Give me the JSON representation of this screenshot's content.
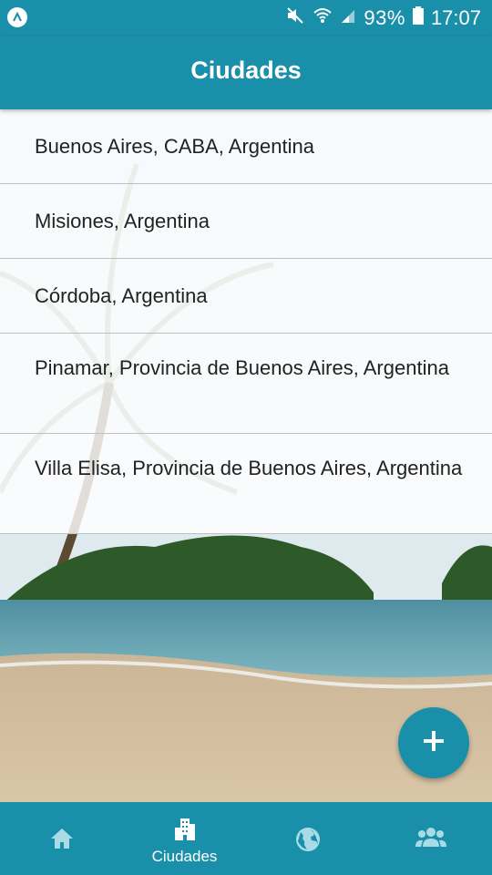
{
  "status_bar": {
    "battery_percent": "93%",
    "time": "17:07",
    "icons": [
      "app-notification-icon",
      "mute-icon",
      "wifi-icon",
      "signal-icon",
      "battery-icon"
    ]
  },
  "app_bar": {
    "title": "Ciudades"
  },
  "cities": [
    "Buenos Aires, CABA, Argentina",
    "Misiones, Argentina",
    "Córdoba, Argentina",
    "Pinamar, Provincia de Buenos Aires, Argentina",
    "Villa Elisa, Provincia de Buenos Aires, Argentina"
  ],
  "fab": {
    "icon": "plus-icon"
  },
  "bottom_nav": {
    "items": [
      {
        "icon": "home-icon",
        "label": "",
        "active": false
      },
      {
        "icon": "city-icon",
        "label": "Ciudades",
        "active": true
      },
      {
        "icon": "globe-icon",
        "label": "",
        "active": false
      },
      {
        "icon": "people-icon",
        "label": "",
        "active": false
      }
    ]
  },
  "colors": {
    "primary": "#1a8fa9",
    "inactive_icon": "#a8dbe6",
    "text": "#222222"
  }
}
